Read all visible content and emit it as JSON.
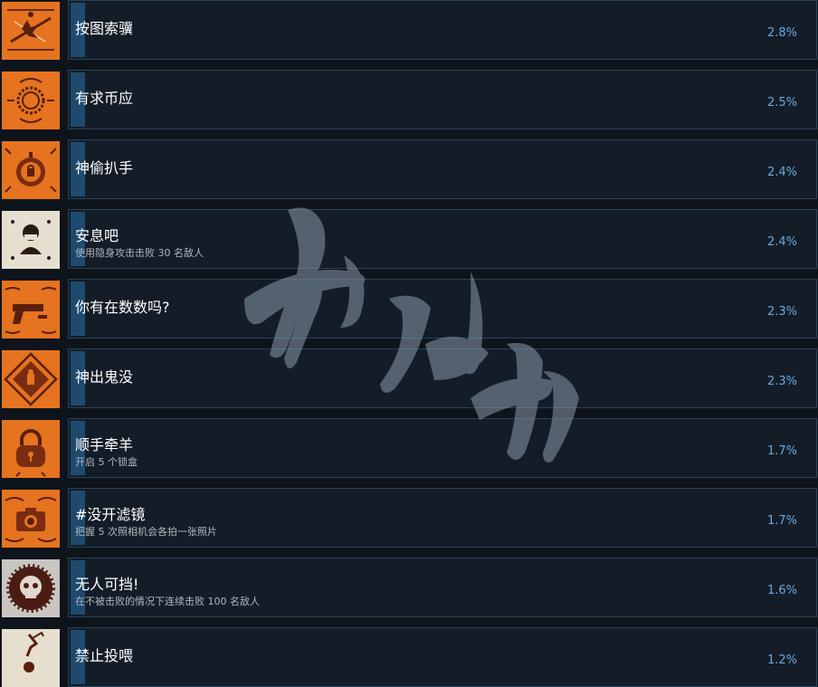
{
  "achievements": [
    {
      "title": "按图索骥",
      "desc": "",
      "percent": "2.8%",
      "progress": 0.028,
      "icon": "map-rope-icon",
      "icon_bg": "#e5731f"
    },
    {
      "title": "有求币应",
      "desc": "",
      "percent": "2.5%",
      "progress": 0.025,
      "icon": "coin-ornament-icon",
      "icon_bg": "#e5731f"
    },
    {
      "title": "神偷扒手",
      "desc": "",
      "percent": "2.4%",
      "progress": 0.024,
      "icon": "pocket-watch-icon",
      "icon_bg": "#e5731f"
    },
    {
      "title": "安息吧",
      "desc": "使用隐身攻击击败 30 名敌人",
      "percent": "2.4%",
      "progress": 0.024,
      "icon": "masked-face-icon",
      "icon_bg": "#e6dfd0"
    },
    {
      "title": "你有在数数吗?",
      "desc": "",
      "percent": "2.3%",
      "progress": 0.023,
      "icon": "pistol-icon",
      "icon_bg": "#e5731f"
    },
    {
      "title": "神出鬼没",
      "desc": "",
      "percent": "2.3%",
      "progress": 0.023,
      "icon": "diamond-emblem-icon",
      "icon_bg": "#e5731f"
    },
    {
      "title": "顺手牵羊",
      "desc": "开启 5 个锁盒",
      "percent": "1.7%",
      "progress": 0.017,
      "icon": "padlock-icon",
      "icon_bg": "#e5731f"
    },
    {
      "title": "#没开滤镜",
      "desc": "把握 5 次照相机会各拍一张照片",
      "percent": "1.7%",
      "progress": 0.017,
      "icon": "camera-icon",
      "icon_bg": "#e5731f"
    },
    {
      "title": "无人可挡!",
      "desc": "在不被击败的情况下连续击败 100 名敌人",
      "percent": "1.6%",
      "progress": 0.016,
      "icon": "skull-sun-icon",
      "icon_bg": "#c9c6c2"
    },
    {
      "title": "禁止投喂",
      "desc": "",
      "percent": "1.2%",
      "progress": 0.012,
      "icon": "hand-fruit-icon",
      "icon_bg": "#e6dfd0"
    }
  ],
  "colors": {
    "panel": "#141d27",
    "border": "#2a4256",
    "percent": "#68a8e0",
    "progress_fill": "#1f4a6e",
    "orange": "#e5731f"
  }
}
